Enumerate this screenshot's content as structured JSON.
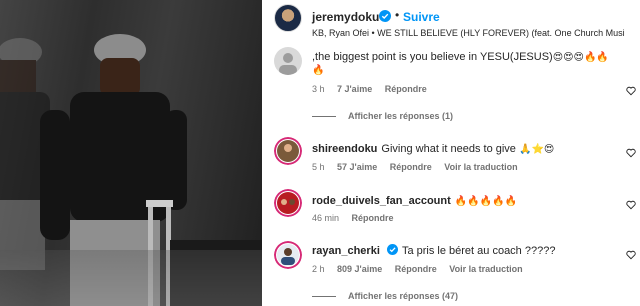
{
  "post": {
    "username": "jeremydoku",
    "follow_label": "Suivre",
    "separator": "•",
    "music": "KB, Ryan Ofei • WE STILL BELIEVE (HLY FOREVER) (feat. One Church Musi"
  },
  "comments": [
    {
      "text_line1": ",the biggest point is you believe in YESU(JESUS)",
      "emojis_line1": "😍😍😍🔥🔥",
      "emojis_line2": "🔥",
      "time": "3 h",
      "likes": "7 J'aime",
      "reply": "Répondre",
      "view_replies": "Afficher les réponses (1)"
    },
    {
      "username": "shireendoku",
      "text": "Giving what it needs to give",
      "emojis": "🙏⭐😍",
      "time": "5 h",
      "likes": "57 J'aime",
      "reply": "Répondre",
      "translate": "Voir la traduction"
    },
    {
      "username": "rode_duivels_fan_account",
      "emojis": "🔥🔥🔥🔥🔥",
      "time": "46 min",
      "reply": "Répondre"
    },
    {
      "username": "rayan_cherki",
      "text": "Ta pris le béret au coach ?????",
      "time": "2 h",
      "likes": "809 J'aime",
      "reply": "Répondre",
      "translate": "Voir la traduction",
      "view_replies": "Afficher les réponses (47)"
    }
  ],
  "colors": {
    "accent": "#0095f6",
    "muted": "#737373",
    "text": "#262626"
  }
}
